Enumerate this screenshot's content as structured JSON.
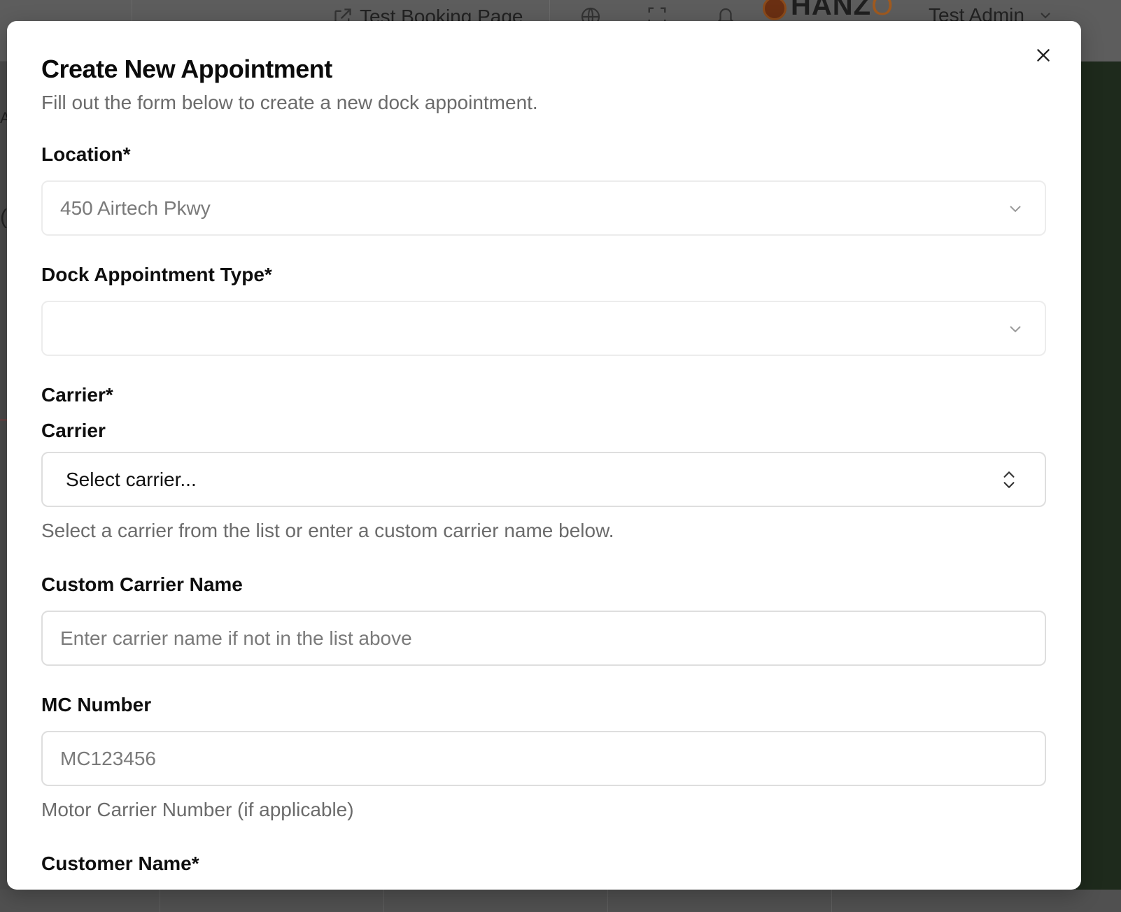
{
  "background": {
    "booking_link": "Test Booking Page",
    "logo_text": "HANZ",
    "logo_accent": "O",
    "user_name": "Test Admin"
  },
  "modal": {
    "title": "Create New Appointment",
    "subtitle": "Fill out the form below to create a new dock appointment.",
    "location": {
      "label": "Location*",
      "value": "450 Airtech Pkwy"
    },
    "dock_type": {
      "label": "Dock Appointment Type*",
      "value": ""
    },
    "carrier": {
      "section_label": "Carrier*",
      "label": "Carrier",
      "placeholder": "Select carrier...",
      "help": "Select a carrier from the list or enter a custom carrier name below."
    },
    "custom_carrier": {
      "label": "Custom Carrier Name",
      "placeholder": "Enter carrier name if not in the list above"
    },
    "mc_number": {
      "label": "MC Number",
      "placeholder": "MC123456",
      "help": "Motor Carrier Number (if applicable)"
    },
    "customer_name": {
      "label": "Customer Name*"
    }
  },
  "icons": {
    "close": "close-icon",
    "location_chevron": "chevron-down-icon",
    "dock_chevron": "chevron-down-icon",
    "carrier_chevron": "chevron-up-down-icon",
    "external_link": "external-link-icon",
    "globe": "globe-icon",
    "fullscreen": "fullscreen-icon",
    "bell": "bell-icon"
  }
}
